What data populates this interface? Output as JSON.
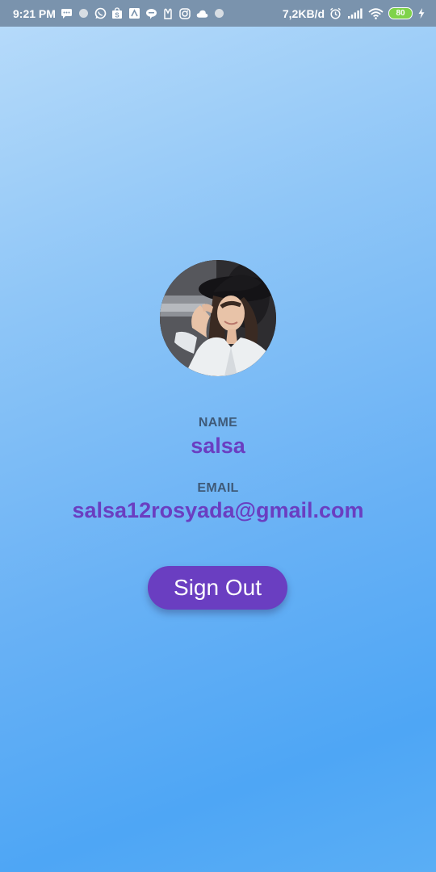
{
  "status_bar": {
    "time": "9:21 PM",
    "network_speed": "7,2KB/d",
    "battery": "80",
    "icons_left": [
      "message-icon",
      "dot-icon",
      "whatsapp-icon",
      "shopee-icon",
      "app-icon",
      "line-icon",
      "app-icon-2",
      "instagram-icon",
      "cloud-icon",
      "dot-icon-2"
    ],
    "icons_right": [
      "alarm-icon",
      "signal-icon",
      "wifi-icon",
      "battery-icon",
      "charging-icon"
    ]
  },
  "profile": {
    "name_label": "NAME",
    "name": "salsa",
    "email_label": "EMAIL",
    "email": "salsa12rosyada@gmail.com"
  },
  "actions": {
    "sign_out_label": "Sign Out"
  },
  "colors": {
    "accent": "#6a3ec1",
    "label": "#3f5a78",
    "status_bar": "#7a93ad"
  }
}
